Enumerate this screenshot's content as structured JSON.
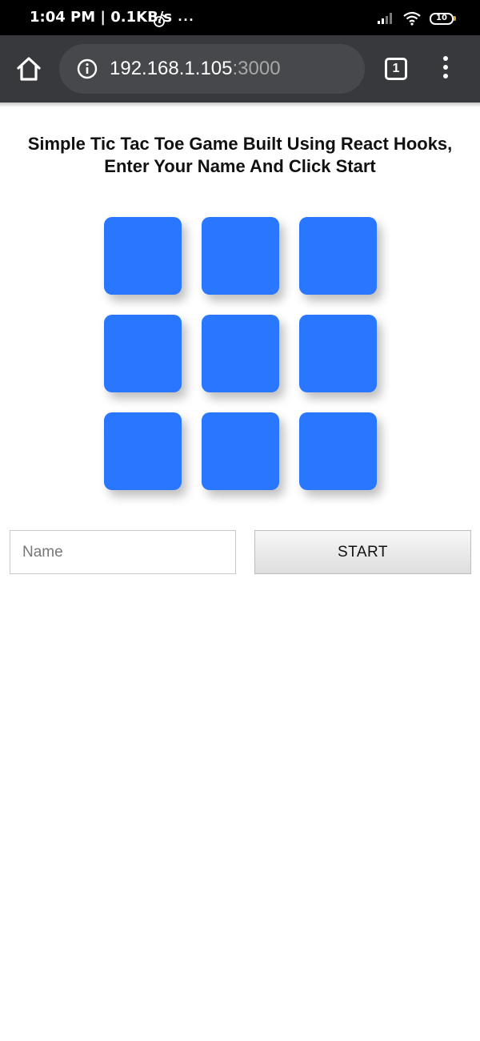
{
  "status_bar": {
    "time_speed": "1:04 PM | 0.1KB/s",
    "more": "···",
    "battery": "10"
  },
  "browser": {
    "url_host": "192.168.1.105",
    "url_port": ":3000",
    "tab_count": "1"
  },
  "page": {
    "heading_line1": "Simple Tic Tac Toe Game Built Using React Hooks,",
    "heading_line2": "Enter Your Name And Click Start",
    "name_placeholder": "Name",
    "name_value": "",
    "start_label": "START"
  },
  "board": {
    "cells": [
      "",
      "",
      "",
      "",
      "",
      "",
      "",
      "",
      ""
    ]
  },
  "colors": {
    "cell": "#2977ff",
    "toolbar": "#37393c",
    "omnibox": "#46484b"
  }
}
